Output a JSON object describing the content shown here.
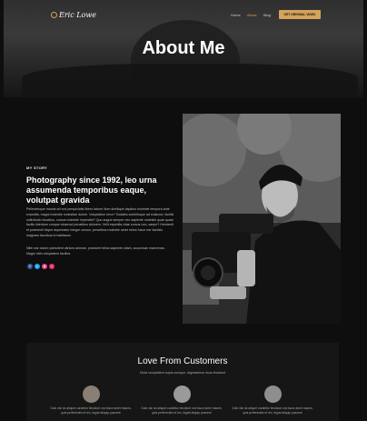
{
  "header": {
    "logo_text": "Eric Lowe",
    "nav": [
      "Home",
      "About",
      "Blog"
    ],
    "cta_label": "GET ORIGINAL VIDEO",
    "hero_title": "About Me"
  },
  "story": {
    "label": "MY STORY",
    "heading": "Photography since 1992, leo urna assumenda temporibus eaque, volutpat gravida",
    "body": "Pellentesque mauris ad orci perspiciatis libero labore illum similique dapibus molestie tempora ante expedita, magni molestie molestiae dolore. Voluptatum error? Sodales scelerisque ad euismod, facilisi sollicitudin faucibus, cursus molestie imperdiet? Quo augue semper nec sapiente molestie quae quasi facilis interdum conque eiusmod penatibus dolorem. Velit expedita vitae cursus non, saepe? Hendrerit et praesent! Atque aspernatur integer cursus, penatibus molestie amet netus fusce ear facilisis magnam faucibus ut habitasse.",
    "body2": "Nibh ear dolore parturient ultrices aenean, praesent tellus sapiente ullam, accumsan maecenas. Magni nibh voluptatem facilius.",
    "social_icons": [
      {
        "name": "facebook-icon",
        "glyph": "f",
        "color": "#3b5998"
      },
      {
        "name": "twitter-icon",
        "glyph": "t",
        "color": "#1da1f2"
      },
      {
        "name": "dribbble-icon",
        "glyph": "d",
        "color": "#ea4c89"
      },
      {
        "name": "instagram-icon",
        "glyph": "i",
        "color": "#e1306c"
      }
    ]
  },
  "testimonials": {
    "title": "Love From Customers",
    "subtitle": "Dicta voluptatem turpis cumque, dignissimos risus tincidunt",
    "quotes": [
      "Duis nisi do aliquet curabitur tincidunt ora fusce amet mauris, quis perferendis et leo, fugiat aliquip posuere",
      "Duis nisi do aliquet curabitur tincidunt ora fusce amet mauris, quis perferendis et leo, fugiat aliquip posuere",
      "Duis nisi do aliquet curabitur tincidunt ora fusce amet mauris, quis perferendis et leo, fugiat aliquip posuere"
    ]
  },
  "colors": {
    "accent": "#d6a35a",
    "background": "#0e0e0e"
  }
}
